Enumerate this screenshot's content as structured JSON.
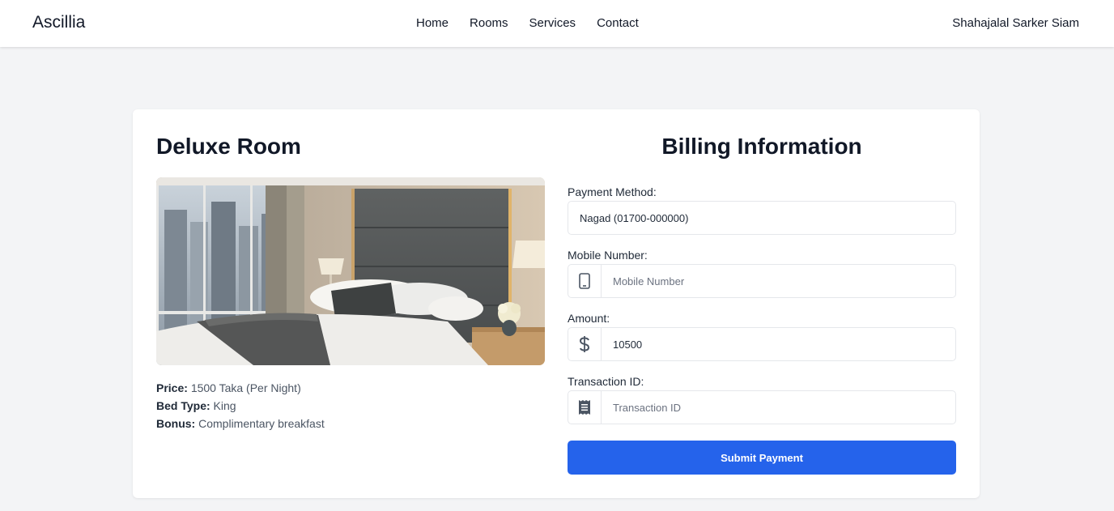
{
  "navbar": {
    "brand": "Ascillia",
    "links": [
      "Home",
      "Rooms",
      "Services",
      "Contact"
    ],
    "user_name": "Shahajalal Sarker Siam"
  },
  "room": {
    "title": "Deluxe Room",
    "image_alt": "hotel-room-photo",
    "price_label": "Price:",
    "price_value": "1500 Taka (Per Night)",
    "bed_label": "Bed Type:",
    "bed_value": "King",
    "bonus_label": "Bonus:",
    "bonus_value": "Complimentary breakfast"
  },
  "billing": {
    "title": "Billing Information",
    "payment_method_label": "Payment Method:",
    "payment_method_value": "Nagad (01700-000000)",
    "mobile_label": "Mobile Number:",
    "mobile_placeholder": "Mobile Number",
    "mobile_icon": "mobile-phone-icon",
    "amount_label": "Amount:",
    "amount_value": "10500",
    "amount_icon": "dollar-icon",
    "transaction_label": "Transaction ID:",
    "transaction_placeholder": "Transaction ID",
    "transaction_icon": "receipt-icon",
    "submit_label": "Submit Payment"
  },
  "colors": {
    "accent": "#2563eb",
    "page_bg": "#f3f4f6",
    "card_bg": "#ffffff"
  }
}
